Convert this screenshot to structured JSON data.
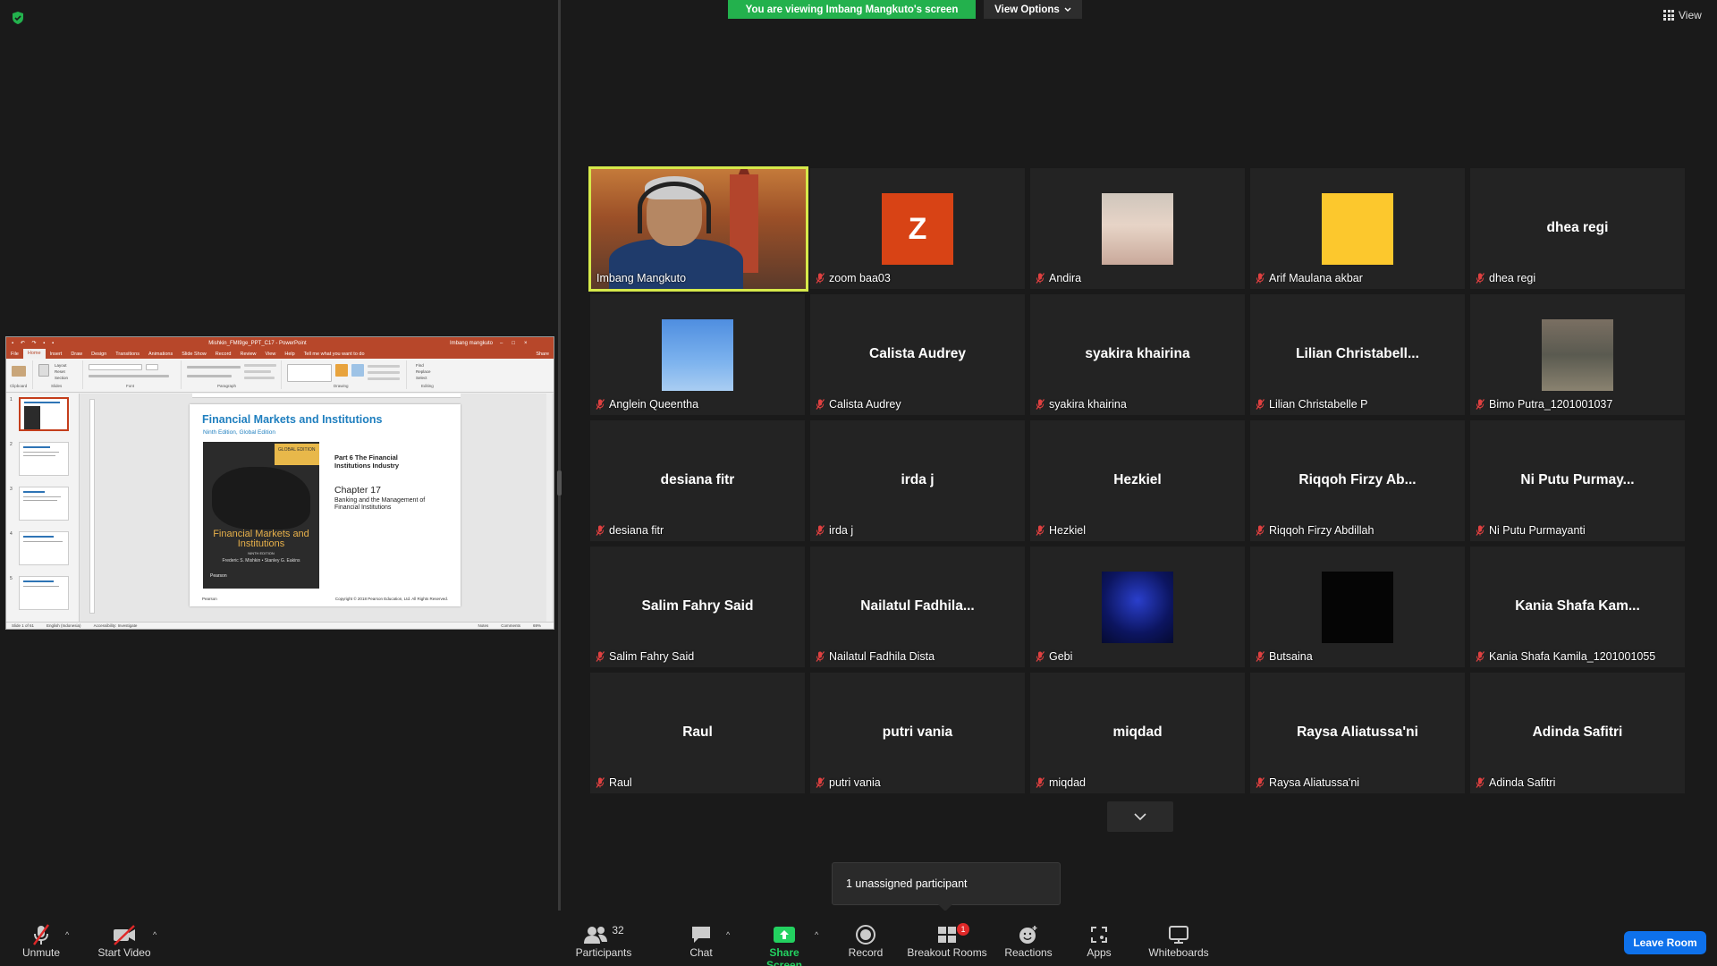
{
  "banner": {
    "viewing_text": "You are viewing Imbang Mangkuto's screen",
    "view_options": "View Options",
    "view": "View"
  },
  "colors": {
    "banner_green": "#23b14d",
    "active_speaker_border": "#d6e94a",
    "leave_blue": "#0e71eb",
    "badge_red": "#e02828"
  },
  "share": {
    "ppt_file_title": "Mishkin_FMI9ge_PPT_C17  -  PowerPoint",
    "ppt_user": "Imbang mangkuto",
    "ppt_tabs": [
      "File",
      "Home",
      "Insert",
      "Draw",
      "Design",
      "Transitions",
      "Animations",
      "Slide Show",
      "Record",
      "Review",
      "View",
      "Help",
      "Tell me what you want to do",
      "Share"
    ],
    "ppt_groups": [
      "Clipboard",
      "Slides",
      "Font",
      "Paragraph",
      "Drawing",
      "Editing"
    ],
    "ppt_slide_ctrls": [
      "Layout",
      "Reset",
      "Section"
    ],
    "ppt_edit_ctrls": [
      "Find",
      "Replace",
      "Select"
    ],
    "slide_title": "Financial Markets and Institutions",
    "slide_subtitle": "Ninth Edition, Global Edition",
    "book_badge": "GLOBAL EDITION",
    "book_title": "Financial Markets and Institutions",
    "book_edition": "NINTH EDITION",
    "book_authors": "Frederic S. Mishkin • Stanley G. Eakins",
    "book_publisher": "Pearson",
    "part": "Part 6 The Financial Institutions Industry",
    "chapter": "Chapter 17",
    "chapter_sub": "Banking and the Management of Financial Institutions",
    "footer_logo": "Pearson",
    "footer_copy": "Copyright © 2018 Pearson Education, Ltd. All Rights Reserved.",
    "status_slide": "Slide 1 of 61",
    "status_lang": "English (Indonesia)",
    "status_access": "Accessibility: Investigate",
    "status_notes": "Notes",
    "status_comments": "Comments",
    "zoom": "69%",
    "thumb_nums": [
      "1",
      "2",
      "3",
      "4",
      "5"
    ]
  },
  "participants": [
    {
      "center": "",
      "label": "Imbang Mangkuto",
      "muted": false,
      "video": true,
      "active": true
    },
    {
      "center": "",
      "label": "zoom baa03",
      "muted": true,
      "avatar": "Z"
    },
    {
      "center": "",
      "label": "Andira",
      "muted": true,
      "photo": "hijab-girl"
    },
    {
      "center": "",
      "label": "Arif Maulana akbar",
      "muted": true,
      "photo": "yellow"
    },
    {
      "center": "dhea regi",
      "label": "dhea regi",
      "muted": true
    },
    {
      "center": "",
      "label": "Anglein Queentha",
      "muted": true,
      "photo": "sky"
    },
    {
      "center": "Calista Audrey",
      "label": "Calista Audrey",
      "muted": true
    },
    {
      "center": "syakira khairina",
      "label": "syakira khairina",
      "muted": true
    },
    {
      "center": "Lilian  Christabell...",
      "label": "Lilian Christabelle P",
      "muted": true
    },
    {
      "center": "",
      "label": "Bimo Putra_1201001037",
      "muted": true,
      "photo": "man-standing"
    },
    {
      "center": "desiana fitr",
      "label": "desiana fitr",
      "muted": true
    },
    {
      "center": "irda j",
      "label": "irda j",
      "muted": true
    },
    {
      "center": "Hezkiel",
      "label": "Hezkiel",
      "muted": true
    },
    {
      "center": "Riqqoh Firzy Ab...",
      "label": "Riqqoh Firzy Abdillah",
      "muted": true
    },
    {
      "center": "Ni Putu Purmay...",
      "label": "Ni Putu Purmayanti",
      "muted": true
    },
    {
      "center": "Salim Fahry Said",
      "label": "Salim Fahry Said",
      "muted": true
    },
    {
      "center": "Nailatul  Fadhila...",
      "label": "Nailatul Fadhila Dista",
      "muted": true
    },
    {
      "center": "",
      "label": "Gebi",
      "muted": true,
      "photo": "blue-dark"
    },
    {
      "center": "",
      "label": "Butsaina",
      "muted": true,
      "photo": "black"
    },
    {
      "center": "Kania Shafa Kam...",
      "label": "Kania Shafa Kamila_1201001055",
      "muted": true
    },
    {
      "center": "Raul",
      "label": "Raul",
      "muted": true
    },
    {
      "center": "putri vania",
      "label": "putri vania",
      "muted": true
    },
    {
      "center": "miqdad",
      "label": "miqdad",
      "muted": true
    },
    {
      "center": "Raysa Aliatussa'ni",
      "label": "Raysa Aliatussa'ni",
      "muted": true
    },
    {
      "center": "Adinda Safitri",
      "label": "Adinda Safitri",
      "muted": true
    }
  ],
  "popup": {
    "unassigned": "1 unassigned participant"
  },
  "toolbar": {
    "unmute": "Unmute",
    "start_video": "Start Video",
    "participants": "Participants",
    "participants_count": "32",
    "chat": "Chat",
    "share_screen": "Share Screen",
    "record": "Record",
    "breakout_rooms": "Breakout Rooms",
    "breakout_badge": "1",
    "reactions": "Reactions",
    "apps": "Apps",
    "whiteboards": "Whiteboards",
    "leave_room": "Leave Room"
  }
}
